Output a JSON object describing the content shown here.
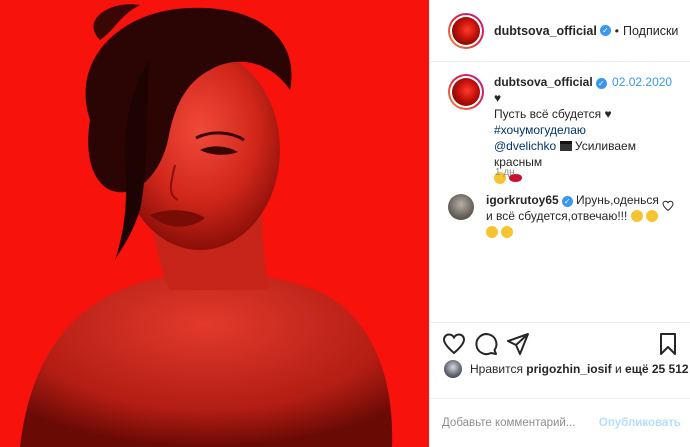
{
  "header": {
    "username": "dubtsova_official",
    "separator": "•",
    "follow_label": "Подписки"
  },
  "caption": {
    "username": "dubtsova_official",
    "date": "02.02.2020",
    "line1": "Пусть всё сбудется",
    "hashtag": "#хочумогуделаю",
    "mention": "@dvelichko",
    "line3": "Усиливаем красным",
    "time_ago": "1 дн."
  },
  "comment": {
    "username": "igorkrutoy65",
    "text": "Ирунь,оденься и всё сбудется,отвечаю!!!"
  },
  "likes": {
    "prefix": "Нравится",
    "username": "prigozhin_iosif",
    "middle": "и",
    "count_text": "ещё 25 512"
  },
  "add_comment": {
    "placeholder": "Добавьте комментарий...",
    "publish_label": "Опубликовать"
  },
  "icons": {
    "like": "heart-icon",
    "comment": "comment-icon",
    "share": "share-icon",
    "save": "bookmark-icon",
    "verified": "verified-badge-icon"
  },
  "colors": {
    "photo_background": "#f7120c",
    "link_blue": "#3897f0",
    "publish_disabled": "#b2dffc"
  }
}
